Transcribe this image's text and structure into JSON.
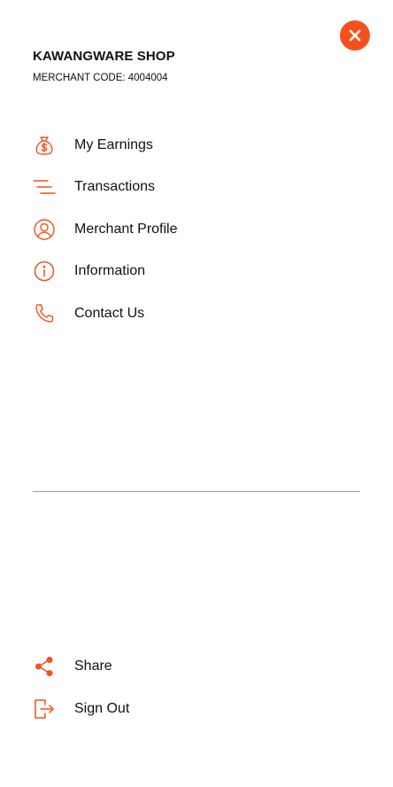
{
  "close_button": {
    "icon": "close-icon",
    "color": "#F4511E"
  },
  "header": {
    "shop_name": "KAWANGWARE SHOP",
    "merchant_code": "MERCHANT CODE: 4004004"
  },
  "menu": {
    "items": [
      {
        "label": "My Earnings",
        "icon": "money-bag-icon"
      },
      {
        "label": "Transactions",
        "icon": "list-lines-icon"
      },
      {
        "label": "Merchant Profile",
        "icon": "user-circle-icon"
      },
      {
        "label": "Information",
        "icon": "info-icon"
      },
      {
        "label": "Contact Us",
        "icon": "phone-icon"
      }
    ]
  },
  "footer": {
    "items": [
      {
        "label": "Share",
        "icon": "share-icon"
      },
      {
        "label": "Sign Out",
        "icon": "sign-out-icon"
      }
    ]
  },
  "colors": {
    "accent": "#F4511E",
    "text": "#111111",
    "divider": "#9E9E9E"
  }
}
